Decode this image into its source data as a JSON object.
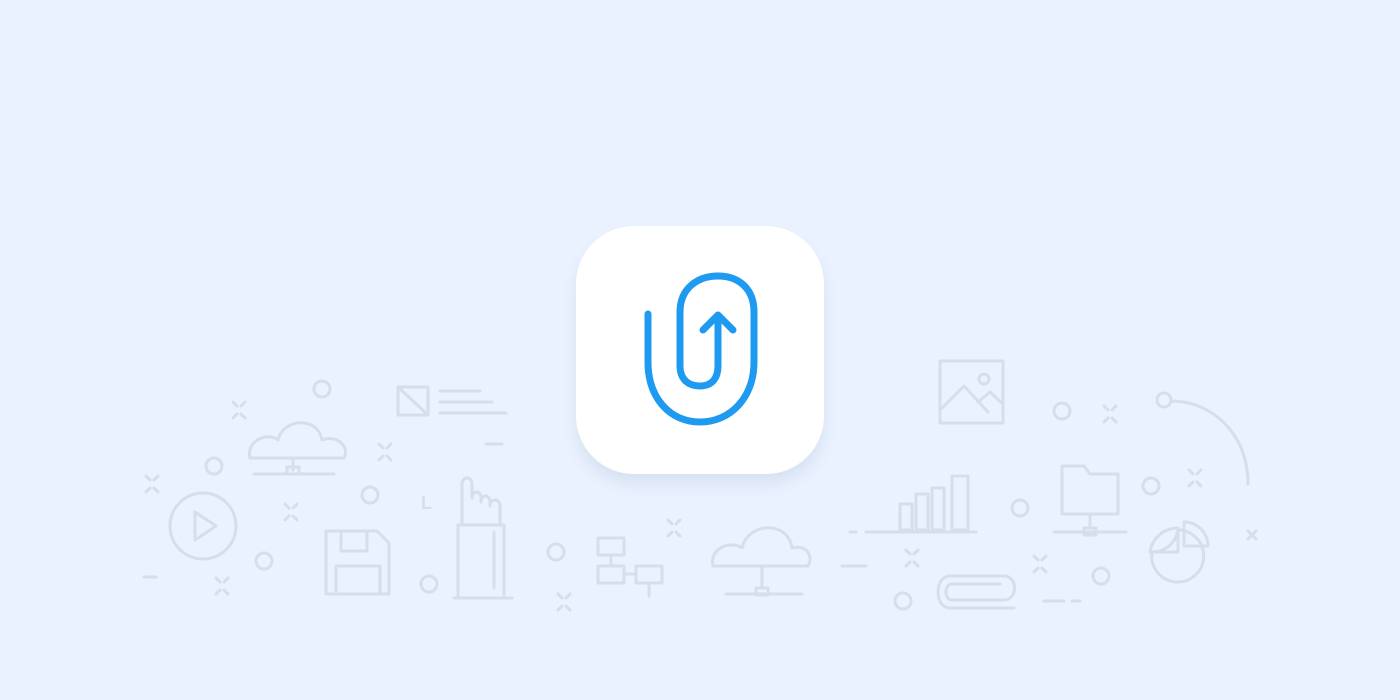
{
  "colors": {
    "background": "#EAF2FE",
    "line_art": "#D6DEEA",
    "icon_tile": "#FFFFFF",
    "accent": "#1E9BF0"
  },
  "app_icon": {
    "glyph": "paperclip-upload-arrow"
  },
  "background_illustration": {
    "icons": [
      "cloud-network-icon",
      "play-button-icon",
      "floppy-disk-icon",
      "document-lines-icon",
      "pointing-hand-icon",
      "flowchart-icon",
      "cloud-network-icon",
      "image-icon",
      "bar-chart-icon",
      "folder-network-icon",
      "pie-chart-icon",
      "paperclip-icon",
      "curve-node-icon"
    ],
    "glyph_text": "L"
  }
}
